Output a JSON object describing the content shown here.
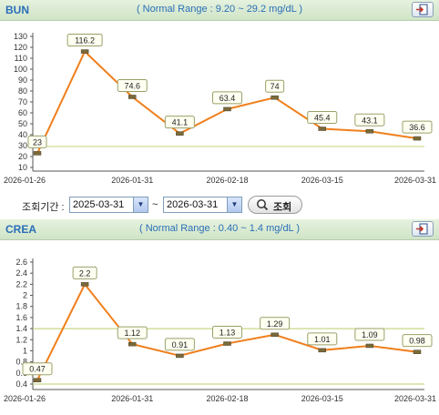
{
  "charts": {
    "bun": {
      "title": "BUN",
      "normal_range": "( Normal Range : 9.20 ~ 29.2 mg/dL )"
    },
    "crea": {
      "title": "CREA",
      "normal_range": "( Normal Range : 0.40 ~ 1.4 mg/dL )"
    }
  },
  "search": {
    "period_label": "조회기간 :",
    "from_date": "2025-03-31",
    "separator": "~",
    "to_date": "2026-03-31",
    "button_label": "조회"
  },
  "colors": {
    "line": "#f07f1c",
    "normal_line": "#c8d98a",
    "header_text": "#2a6fb8"
  },
  "chart_data": [
    {
      "type": "line",
      "title": "BUN",
      "values": [
        23,
        116.2,
        74.6,
        41.1,
        63.4,
        74,
        45.4,
        43.1,
        36.6
      ],
      "value_labels": [
        "23",
        "116.2",
        "74.6",
        "41.1",
        "63.4",
        "74",
        "45.4",
        "43.1",
        "36.6"
      ],
      "xticks": [
        "2026-01-26",
        "2026-01-31",
        "2026-02-18",
        "2026-03-15",
        "2026-03-31"
      ],
      "yticks": [
        "10",
        "20",
        "30",
        "40",
        "50",
        "60",
        "70",
        "80",
        "90",
        "100",
        "110",
        "120",
        "130"
      ],
      "ylim": [
        10,
        130
      ],
      "normal_range": [
        9.2,
        29.2
      ],
      "grid": false
    },
    {
      "type": "line",
      "title": "CREA",
      "values": [
        0.47,
        2.2,
        1.12,
        0.91,
        1.13,
        1.29,
        1.01,
        1.09,
        0.98
      ],
      "value_labels": [
        "0.47",
        "2.2",
        "1.12",
        "0.91",
        "1.13",
        "1.29",
        "1.01",
        "1.09",
        "0.98"
      ],
      "xticks": [
        "2026-01-26",
        "2026-01-31",
        "2026-02-18",
        "2026-03-15",
        "2026-03-31"
      ],
      "yticks": [
        "0.4",
        "0.6",
        "0.8",
        "1",
        "1.2",
        "1.4",
        "1.6",
        "1.8",
        "2",
        "2.2",
        "2.4",
        "2.6"
      ],
      "ylim": [
        0.4,
        2.6
      ],
      "normal_range": [
        0.4,
        1.4
      ],
      "grid": false
    }
  ]
}
